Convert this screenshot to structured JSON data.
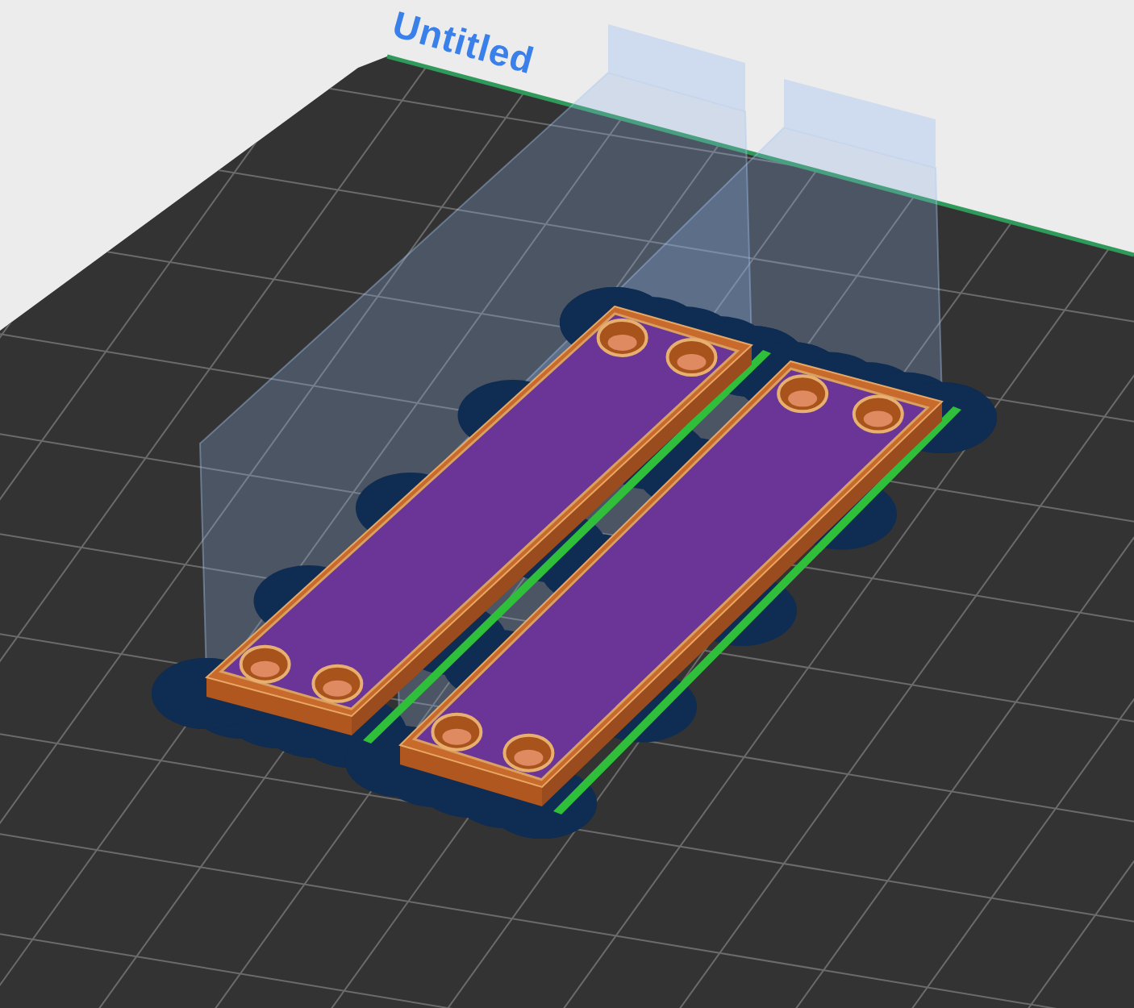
{
  "plate": {
    "name": "Untitled"
  }
}
